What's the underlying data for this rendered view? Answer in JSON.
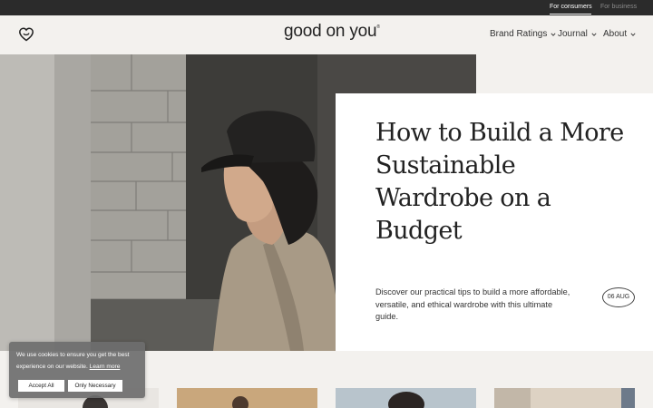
{
  "topbar": {
    "consumers_label": "For consumers",
    "business_label": "For business"
  },
  "header": {
    "brand_name": "good on you",
    "brand_mark": "®",
    "nav": [
      {
        "label": "Brand Ratings"
      },
      {
        "label": "Journal"
      },
      {
        "label": "About"
      }
    ]
  },
  "hero": {
    "title": "How to Build a More Sustainable Wardrobe on a Budget",
    "description": "Discover our practical tips to build a more affordable, versatile, and ethical wardrobe with this ultimate guide.",
    "date": "06 AUG"
  },
  "cookie": {
    "text": "We use cookies to ensure you get the best experience on our website.",
    "learn_more": "Learn more",
    "accept_label": "Accept All",
    "necessary_label": "Only Necessary"
  },
  "colors": {
    "topbar_bg": "#2b2b2b",
    "page_bg": "#f3f1ee",
    "card_bg": "#ffffff",
    "text": "#222222"
  }
}
